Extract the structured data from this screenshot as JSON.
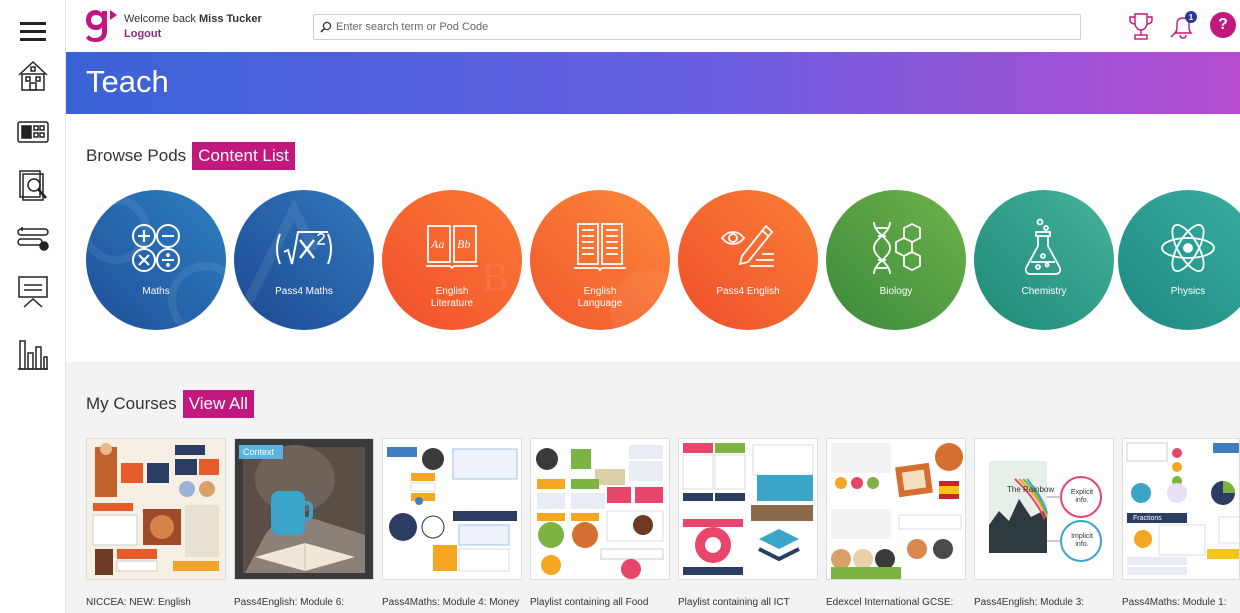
{
  "header": {
    "welcome_prefix": "Welcome back",
    "user_name": "Miss Tucker",
    "logout_label": "Logout",
    "search_placeholder": "Enter search term or Pod Code",
    "notification_count": "1",
    "help_label": "?"
  },
  "banner": {
    "title": "Teach"
  },
  "browse": {
    "heading": "Browse Pods",
    "button_label": "Content List",
    "pods": [
      {
        "line1": "Maths",
        "line2": "",
        "color_from": "#1f4f9a",
        "color_to": "#2d7fc0",
        "icon": "math-operators-icon"
      },
      {
        "line1": "Pass4 Maths",
        "line2": "",
        "color_from": "#1c4a92",
        "color_to": "#3278bd",
        "icon": "square-root-icon"
      },
      {
        "line1": "English",
        "line2": "Literature",
        "color_from": "#f14f2c",
        "color_to": "#fb7a35",
        "icon": "font-sample-icon"
      },
      {
        "line1": "English",
        "line2": "Language",
        "color_from": "#f2572d",
        "color_to": "#fb8a3a",
        "icon": "open-book-icon"
      },
      {
        "line1": "Pass4 English",
        "line2": "",
        "color_from": "#ef4f2b",
        "color_to": "#fb7f36",
        "icon": "eye-pencil-icon"
      },
      {
        "line1": "Biology",
        "line2": "",
        "color_from": "#3a8a3c",
        "color_to": "#6fb24a",
        "icon": "dna-icon"
      },
      {
        "line1": "Chemistry",
        "line2": "",
        "color_from": "#1e8a78",
        "color_to": "#45b29a",
        "icon": "flask-icon"
      },
      {
        "line1": "Physics",
        "line2": "",
        "color_from": "#1d8a82",
        "color_to": "#3aaea2",
        "icon": "atom-icon"
      }
    ]
  },
  "courses": {
    "heading": "My Courses",
    "button_label": "View All",
    "items": [
      {
        "title": "NICCEA: NEW: English"
      },
      {
        "title": "Pass4English: Module 6:",
        "thumb_label": "Context"
      },
      {
        "title": "Pass4Maths: Module 4: Money"
      },
      {
        "title": "Playlist containing all Food"
      },
      {
        "title": "Playlist containing all ICT"
      },
      {
        "title": "Edexcel International GCSE:"
      },
      {
        "title": "Pass4English: Module 3:",
        "thumb_title": "The Rainbow",
        "thumb_a": "Explicit info.",
        "thumb_b": "Implicit info."
      },
      {
        "title": "Pass4Maths: Module 1:",
        "thumb_label": "Fractions"
      }
    ]
  },
  "colors": {
    "accent": "#c2177c",
    "banner_start": "#3a63d6",
    "banner_end": "#b64dd0"
  }
}
